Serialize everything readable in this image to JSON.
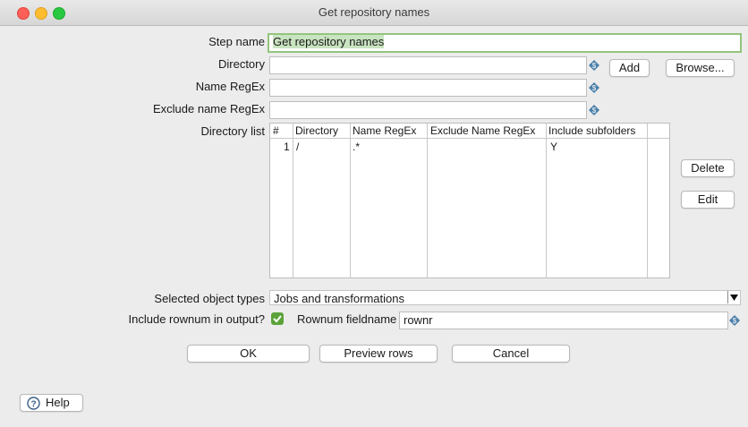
{
  "window": {
    "title": "Get repository names"
  },
  "form": {
    "step_name_label": "Step name",
    "step_name_value": "Get repository names",
    "directory_label": "Directory",
    "directory_value": "",
    "name_regex_label": "Name RegEx",
    "name_regex_value": "",
    "exclude_label": "Exclude name RegEx",
    "exclude_value": "",
    "add_button": "Add",
    "browse_button": "Browse...",
    "directory_list_label": "Directory list",
    "delete_button": "Delete",
    "edit_button": "Edit"
  },
  "table": {
    "columns": [
      "#",
      "Directory",
      "Name RegEx",
      "Exclude Name RegEx",
      "Include subfolders"
    ],
    "rows": [
      {
        "num": "1",
        "directory": "/",
        "name_regex": ".*",
        "exclude": "",
        "include_subfolders": "Y"
      }
    ]
  },
  "options": {
    "object_types_label": "Selected object types",
    "object_types_value": "Jobs and transformations",
    "include_rownum_label": "Include rownum in output?",
    "include_rownum_checked": true,
    "rownum_field_label": "Rownum fieldname",
    "rownum_field_value": "rownr"
  },
  "footer": {
    "ok": "OK",
    "preview": "Preview rows",
    "cancel": "Cancel",
    "help": "Help"
  },
  "colors": {
    "focus_border": "#93c47d",
    "checkbox": "#5aa33a",
    "variable_icon": "#4b7fa8"
  }
}
